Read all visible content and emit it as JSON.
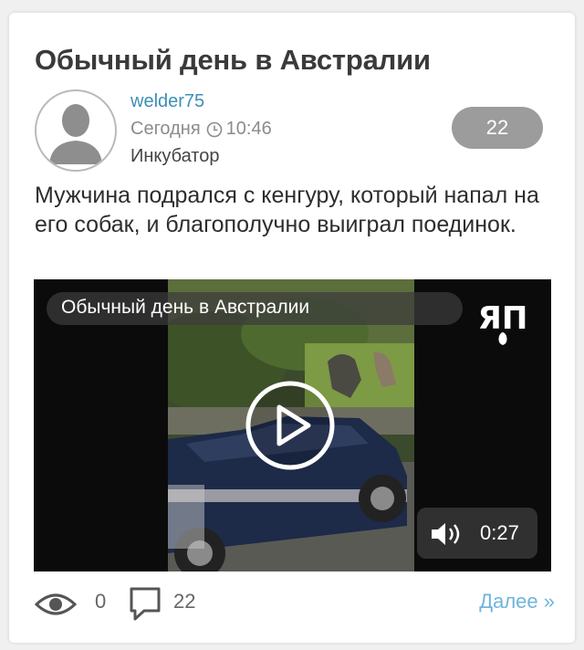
{
  "post": {
    "title": "Обычный день в Австралии",
    "author": "welder75",
    "date_label": "Сегодня",
    "time": "10:46",
    "community": "Инкубатор",
    "rating": "22",
    "text": "Мужчина подрался с кенгуру, который напал на его собак, и благополучно выиграл поединок."
  },
  "video": {
    "caption": "Обычный день в Австралии",
    "logo_text": "ЯП",
    "duration": "0:27"
  },
  "footer": {
    "views": "0",
    "comments": "22",
    "more_link": "Далее »"
  },
  "icons": {
    "avatar": "user-silhouette-icon",
    "clock": "clock-icon",
    "play": "play-icon",
    "speaker": "speaker-icon",
    "views": "eye-icon",
    "comments": "comment-bubble-icon"
  },
  "colors": {
    "author": "#3d8fb5",
    "rating_bg": "#9c9c9c",
    "more_link": "#6fb5dd",
    "title": "#3a3a3a"
  }
}
